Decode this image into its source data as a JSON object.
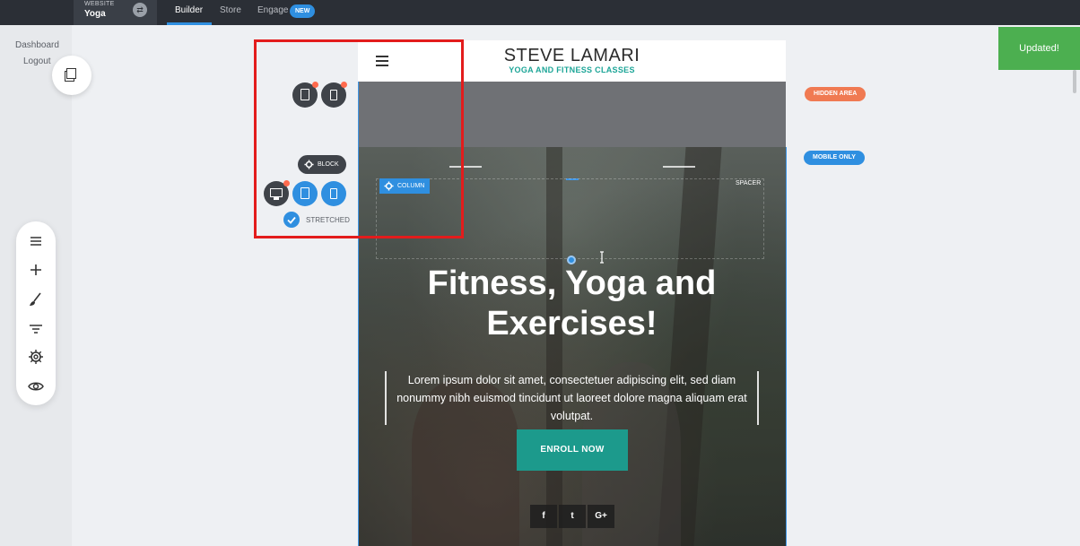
{
  "topbar": {
    "site_label": "WEBSITE",
    "site_name": "Yoga",
    "tabs": [
      {
        "label": "Builder"
      },
      {
        "label": "Store"
      },
      {
        "label": "Engage"
      }
    ],
    "new_badge": "NEW"
  },
  "left_nav": {
    "dashboard": "Dashboard",
    "logout": "Logout"
  },
  "toolbar": {
    "icons": [
      "menu-icon",
      "add-icon",
      "brush-icon",
      "filter-icon",
      "settings-icon",
      "eye-icon"
    ]
  },
  "controls": {
    "block_label": "BLOCK",
    "column_label": "COLUMN",
    "stretched_label": "STRETCHED",
    "spacer_label": "SPACER"
  },
  "page": {
    "brand_name": "STEVE LAMARI",
    "brand_tagline": "YOGA AND FITNESS CLASSES",
    "hero_title_line1": "Fitness, Yoga and",
    "hero_title_line2": "Exercises!",
    "hero_text": "Lorem ipsum dolor sit amet, consectetuer adipiscing elit, sed diam nonummy nibh euismod tincidunt ut laoreet dolore magna aliquam erat volutpat.",
    "cta_label": "ENROLL NOW",
    "social": [
      "f",
      "t",
      "G+"
    ]
  },
  "tags": {
    "hidden_area": "HIDDEN AREA",
    "mobile_only": "MOBILE ONLY"
  },
  "toast": "Updated!",
  "colors": {
    "accent_blue": "#2f8fe0",
    "teal": "#1c9a8c",
    "highlight_red": "#e31c1c",
    "toast_green": "#4caf50",
    "hidden_tag": "#f07a52"
  }
}
